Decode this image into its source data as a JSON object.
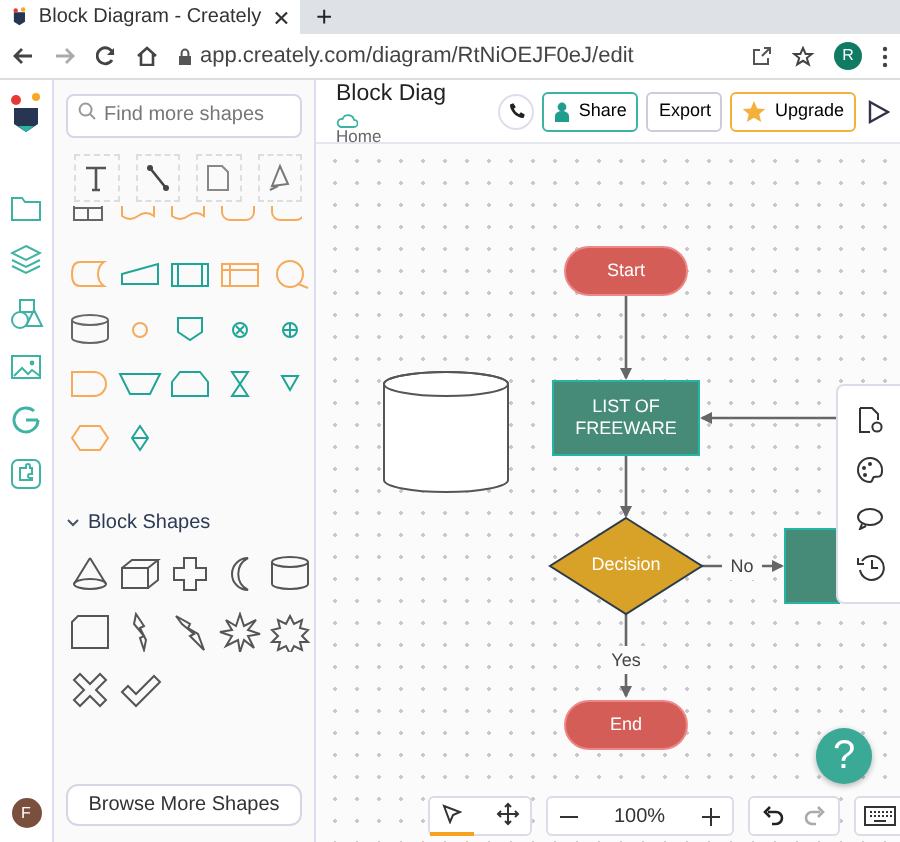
{
  "browser": {
    "tab_title": "Block Diagram - Creately",
    "new_tab": "+",
    "url": "app.creately.com/diagram/RtNiOEJF0eJ/edit",
    "profile": "R"
  },
  "header": {
    "title": "Block Diag",
    "breadcrumb": "Home",
    "buttons": [
      {
        "label": "Share",
        "kind": "share"
      },
      {
        "label": "Export",
        "kind": "plain"
      },
      {
        "label": "Upgrade",
        "kind": "upgrade"
      }
    ]
  },
  "shapes_panel": {
    "search": {
      "placeholder": "Find more shapes"
    },
    "section": {
      "title": "Block Shapes",
      "expanded": true
    },
    "browse_button": "Browse More Shapes"
  },
  "user": {
    "initial": "F"
  },
  "diagram": {
    "nodes": [
      {
        "kind": "terminator",
        "text": "Start"
      },
      {
        "kind": "database"
      },
      {
        "kind": "process",
        "text": "LIST OF FREEWARE"
      },
      {
        "kind": "decision",
        "text": "Decision"
      },
      {
        "kind": "process"
      },
      {
        "kind": "terminator",
        "text": "End"
      }
    ],
    "edge_labels": [
      "No",
      "Yes"
    ]
  },
  "toolbar": {
    "tools": [
      {
        "kind": "select",
        "selected": true
      },
      {
        "kind": "pan",
        "selected": false
      }
    ],
    "zoom": "100%"
  },
  "help": "?"
}
